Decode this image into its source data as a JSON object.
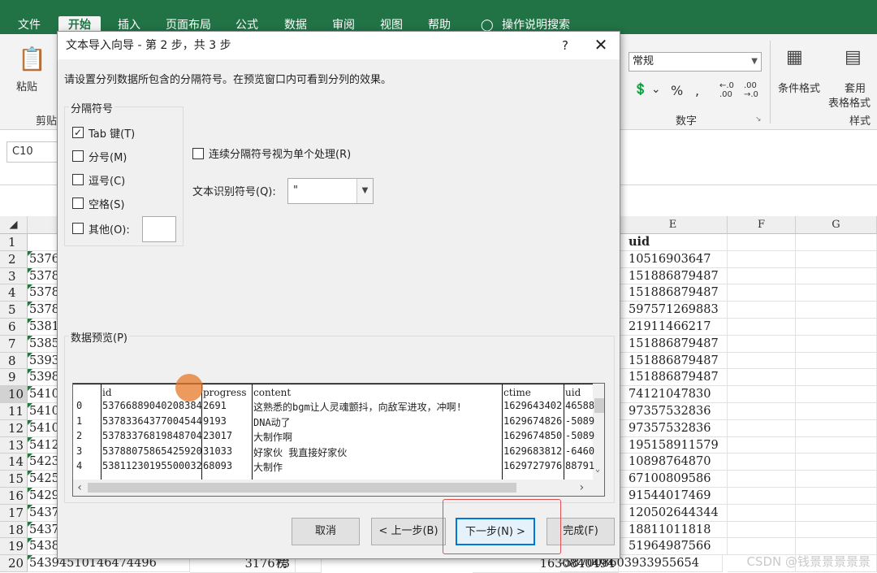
{
  "menu": {
    "tabs": [
      "文件",
      "开始",
      "插入",
      "页面布局",
      "公式",
      "数据",
      "审阅",
      "视图",
      "帮助",
      "操作说明搜索"
    ],
    "active_tab": "开始"
  },
  "ribbon": {
    "paste": "粘贴",
    "clipboard": "剪贴",
    "number_format": "常规",
    "number_group": "数字",
    "conditional": "条件格式",
    "table_format_1": "套用",
    "table_format_2": "表格格式",
    "styles_group": "样式"
  },
  "name_box": "C10",
  "grid": {
    "columns": [
      "E",
      "F",
      "G"
    ],
    "rows": [
      "1",
      "2",
      "3",
      "4",
      "5",
      "6",
      "7",
      "8",
      "9",
      "10",
      "11",
      "12",
      "13",
      "14",
      "15",
      "16",
      "17",
      "18",
      "19",
      "20"
    ],
    "selected_row": "10",
    "col_a": [
      "",
      "5376",
      "5378",
      "5378",
      "5378",
      "5381",
      "5385",
      "5393",
      "5398",
      "5410",
      "5410",
      "5410",
      "5412",
      "5423",
      "5425",
      "5429",
      "5437",
      "5437",
      "5438",
      "54394510146474496"
    ],
    "col_e": [
      "uid",
      "10516903647",
      "151886879487",
      "151886879487",
      "597571269883",
      "21911466217",
      "151886879487",
      "151886879487",
      "151886879487",
      "74121047830",
      "97357532836",
      "97357532836",
      "195158911579",
      "10898764870",
      "67100809586",
      "91544017469",
      "120502644344",
      "18811011818",
      "51964987566",
      "-587008603933955654"
    ],
    "row20_c": "317673",
    "row20_d": "楞",
    "row20_ctime": "1630840494"
  },
  "dialog": {
    "title": "文本导入向导 - 第 2 步，共 3 步",
    "help": "?",
    "close": "✕",
    "instruction": "请设置分列数据所包含的分隔符号。在预览窗口内可看到分列的效果。",
    "delimiters_legend": "分隔符号",
    "delimiters": [
      {
        "label": "Tab 键(T)",
        "checked": true
      },
      {
        "label": "分号(M)",
        "checked": false
      },
      {
        "label": "逗号(C)",
        "checked": false
      },
      {
        "label": "空格(S)",
        "checked": false
      },
      {
        "label": "其他(O):",
        "checked": false
      }
    ],
    "consecutive": "连续分隔符号视为单个处理(R)",
    "qualifier_label": "文本识别符号(Q):",
    "qualifier_value": "\"",
    "preview_label": "数据预览(P)",
    "preview": {
      "headers": [
        "id",
        "progress",
        "content",
        "ctime",
        "uid"
      ],
      "rows": [
        [
          "0",
          "53766889040208384",
          "2691",
          "这熟悉的bgm让人灵魂颤抖，向敌军进攻，冲啊!",
          "1629643402",
          "46588"
        ],
        [
          "1",
          "53783364377004544",
          "9193",
          "DNA动了",
          "1629674826",
          "-5089"
        ],
        [
          "2",
          "53783376819848704",
          "23017",
          "大制作啊",
          "1629674850",
          "-5089"
        ],
        [
          "3",
          "53788075865425920",
          "31033",
          "好家伙 我直接好家伙",
          "1629683812",
          "-6460"
        ],
        [
          "4",
          "53811230195500032",
          "68093",
          "大制作",
          "1629727976",
          "88791"
        ]
      ]
    },
    "buttons": {
      "cancel": "取消",
      "back": "< 上一步(B)",
      "next": "下一步(N) >",
      "finish": "完成(F)"
    }
  },
  "watermark": "CSDN @钱景景景景景"
}
